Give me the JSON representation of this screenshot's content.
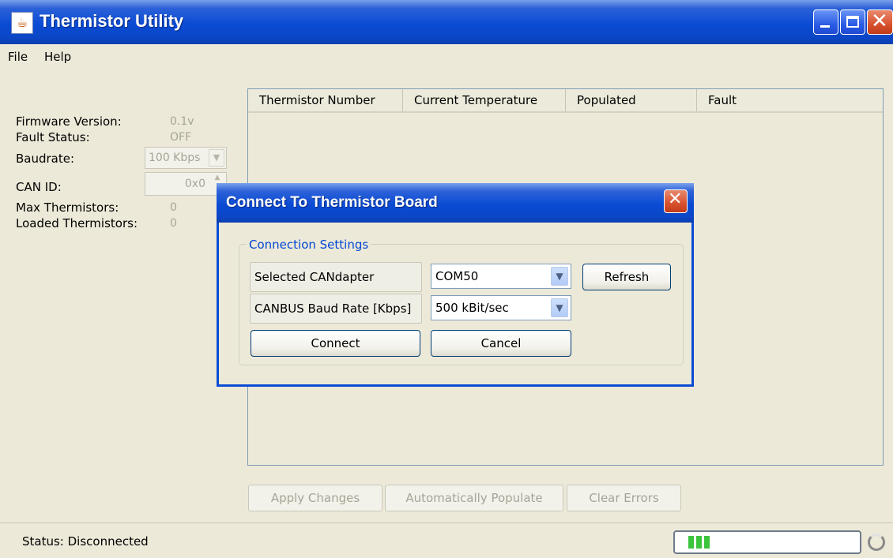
{
  "window": {
    "title": "Thermistor Utility",
    "app_icon": "java-cup-icon"
  },
  "menu": {
    "items": [
      "File",
      "Help"
    ]
  },
  "info": {
    "firmware_label": "Firmware Version:",
    "firmware_value": "0.1v",
    "fault_label": "Fault Status:",
    "fault_value": "OFF",
    "baudrate_label": "Baudrate:",
    "baudrate_value": "100 Kbps",
    "canid_label": "CAN ID:",
    "canid_value": "0x0",
    "max_label": "Max Thermistors:",
    "max_value": "0",
    "loaded_label": "Loaded Thermistors:",
    "loaded_value": "0"
  },
  "table": {
    "columns": [
      "Thermistor Number",
      "Current Temperature",
      "Populated",
      "Fault"
    ]
  },
  "actions": {
    "apply": "Apply Changes",
    "populate": "Automatically Populate",
    "clear": "Clear Errors"
  },
  "status": {
    "text": "Status: Disconnected",
    "progress_blocks": 3
  },
  "dialog": {
    "title": "Connect To Thermistor Board",
    "group_title": "Connection Settings",
    "candapter_label": "Selected CANdapter",
    "candapter_value": "COM50",
    "refresh": "Refresh",
    "baud_label": "CANBUS Baud Rate [Kbps]",
    "baud_value": "500 kBit/sec",
    "connect": "Connect",
    "cancel": "Cancel"
  },
  "colors": {
    "accent": "#0a4bd4",
    "legend": "#0046d5",
    "disabled_text": "#a6a496",
    "progress": "#3cc43c"
  }
}
